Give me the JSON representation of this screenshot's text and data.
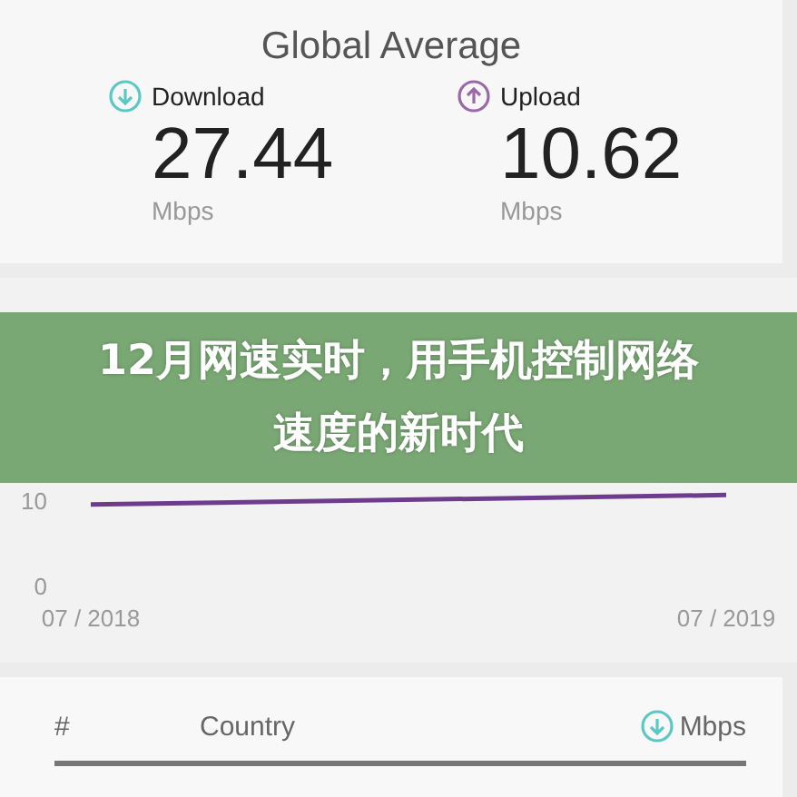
{
  "summary": {
    "title": "Global Average",
    "metrics": [
      {
        "kind": "download",
        "label": "Download",
        "value": "27.44",
        "unit": "Mbps"
      },
      {
        "kind": "upload",
        "label": "Upload",
        "value": "10.62",
        "unit": "Mbps"
      }
    ]
  },
  "chart": {
    "chart_data": {
      "type": "line",
      "x": [
        "07 / 2018",
        "07 / 2019"
      ],
      "ylim": [
        -9,
        36
      ],
      "yticks": [
        0,
        10
      ],
      "series": [
        {
          "color": "#6e3c8c",
          "values": [
            9.5,
            10.6
          ]
        }
      ]
    }
  },
  "banner": {
    "title": "12月网速实时，用手机控制网络速度的新时代"
  },
  "table": {
    "columns": [
      {
        "kind": "text",
        "label": "#"
      },
      {
        "kind": "text",
        "label": "Country"
      },
      {
        "kind": "download",
        "label": "Mbps"
      }
    ]
  }
}
